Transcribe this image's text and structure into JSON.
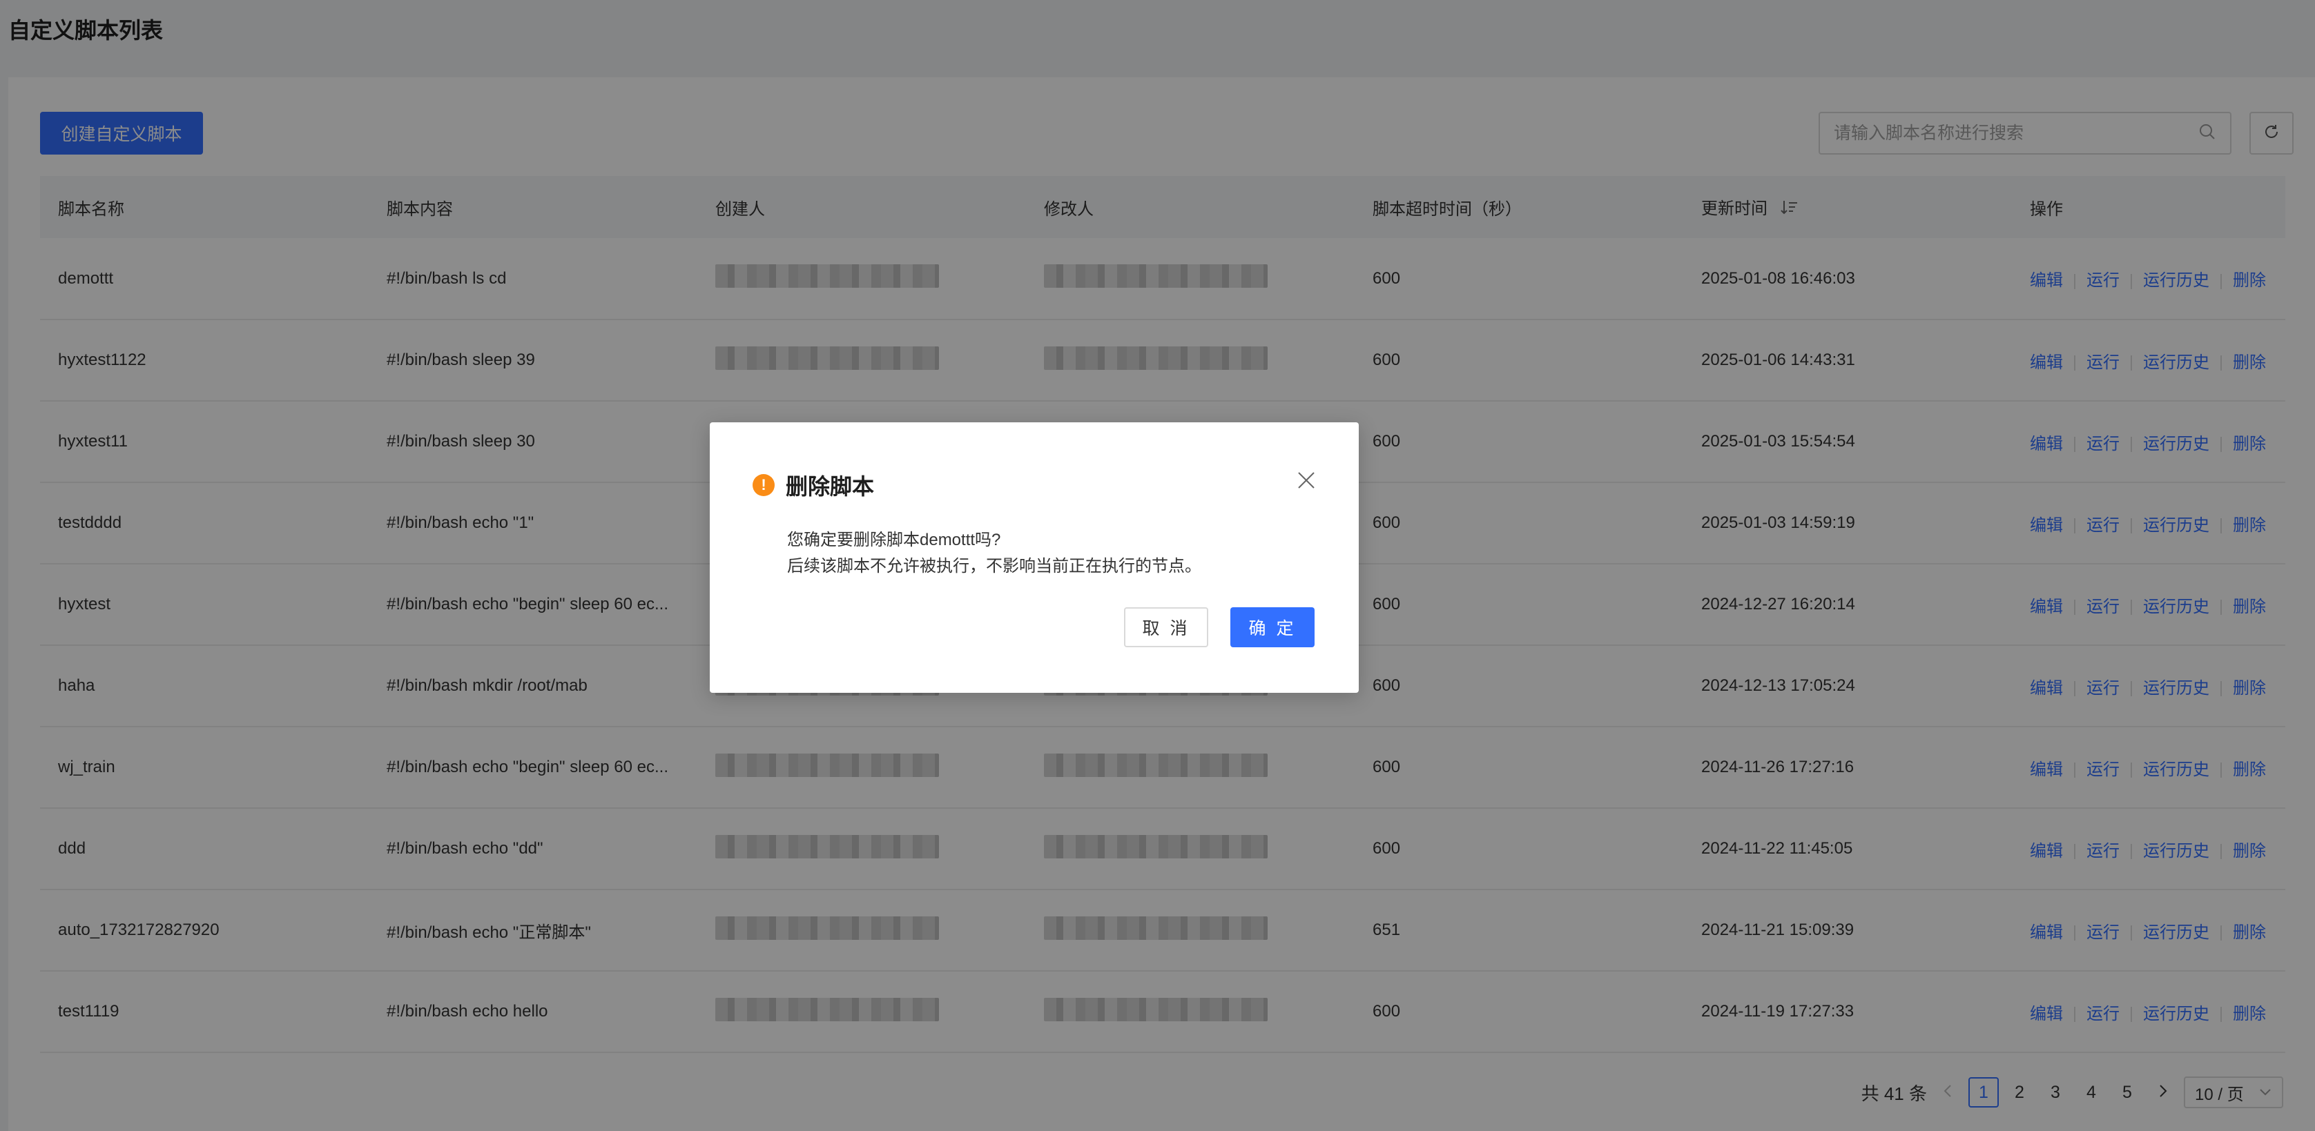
{
  "page": {
    "title": "自定义脚本列表"
  },
  "toolbar": {
    "create_label": "创建自定义脚本",
    "search_placeholder": "请输入脚本名称进行搜索"
  },
  "table": {
    "headers": [
      "脚本名称",
      "脚本内容",
      "创建人",
      "修改人",
      "脚本超时时间（秒）",
      "更新时间",
      "操作"
    ],
    "ops_labels": {
      "edit": "编辑",
      "run": "运行",
      "history": "运行历史",
      "delete": "删除"
    },
    "rows": [
      {
        "name": "demottt",
        "content": "#!/bin/bash ls cd",
        "timeout": "600",
        "updated": "2025-01-08 16:46:03"
      },
      {
        "name": "hyxtest1122",
        "content": "#!/bin/bash sleep 39",
        "timeout": "600",
        "updated": "2025-01-06 14:43:31"
      },
      {
        "name": "hyxtest11",
        "content": "#!/bin/bash sleep 30",
        "timeout": "600",
        "updated": "2025-01-03 15:54:54"
      },
      {
        "name": "testdddd",
        "content": "#!/bin/bash echo \"1\"",
        "timeout": "600",
        "updated": "2025-01-03 14:59:19"
      },
      {
        "name": "hyxtest",
        "content": "#!/bin/bash echo \"begin\" sleep 60 ec...",
        "timeout": "600",
        "updated": "2024-12-27 16:20:14"
      },
      {
        "name": "haha",
        "content": "#!/bin/bash mkdir /root/mab",
        "timeout": "600",
        "updated": "2024-12-13 17:05:24"
      },
      {
        "name": "wj_train",
        "content": "#!/bin/bash echo \"begin\" sleep 60 ec...",
        "timeout": "600",
        "updated": "2024-11-26 17:27:16"
      },
      {
        "name": "ddd",
        "content": "#!/bin/bash echo \"dd\"",
        "timeout": "600",
        "updated": "2024-11-22 11:45:05"
      },
      {
        "name": "auto_1732172827920",
        "content": "#!/bin/bash echo \"正常脚本\"",
        "timeout": "651",
        "updated": "2024-11-21 15:09:39"
      },
      {
        "name": "test1119",
        "content": "#!/bin/bash echo hello",
        "timeout": "600",
        "updated": "2024-11-19 17:27:33"
      }
    ]
  },
  "pagination": {
    "total_label": "共 41 条",
    "pages": [
      "1",
      "2",
      "3",
      "4",
      "5"
    ],
    "current": "1",
    "page_size_label": "10 / 页"
  },
  "dialog": {
    "title": "删除脚本",
    "line1": "您确定要删除脚本demottt吗?",
    "line2": "后续该脚本不允许被执行，不影响当前正在执行的节点。",
    "cancel_label": "取 消",
    "ok_label": "确 定"
  },
  "colors": {
    "primary": "#3370ff",
    "warning": "#fa8c16",
    "mask": "rgba(0,0,0,0.45)"
  }
}
